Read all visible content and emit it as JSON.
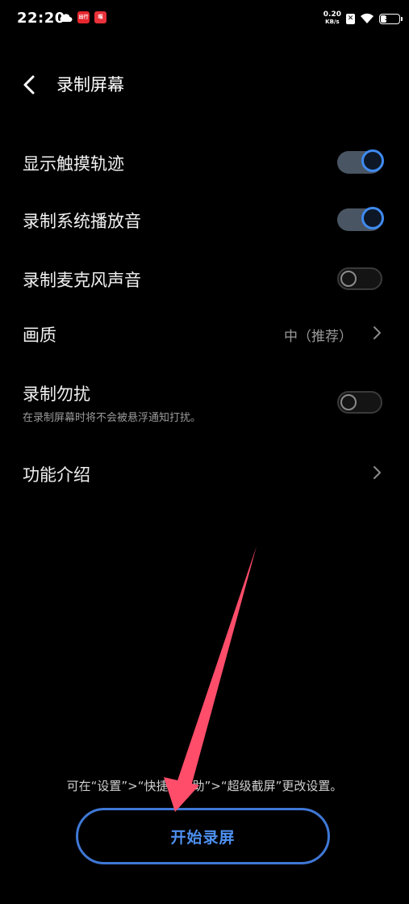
{
  "status_bar": {
    "time": "22:20",
    "badge_1": "出行",
    "badge_2": "喵",
    "net_speed_value": "0.20",
    "net_speed_unit": "KB/s",
    "battery": "38",
    "battery_level_percent": 38
  },
  "header": {
    "title": "录制屏幕"
  },
  "settings": {
    "show_touch": {
      "label": "显示触摸轨迹",
      "state": "on"
    },
    "record_system_audio": {
      "label": "录制系统播放音",
      "state": "on"
    },
    "record_mic": {
      "label": "录制麦克风声音",
      "state": "off"
    },
    "quality": {
      "label": "画质",
      "value": "中（推荐）"
    },
    "dnd": {
      "label": "录制勿扰",
      "description": "在录制屏幕时将不会被悬浮通知打扰。",
      "state": "off"
    },
    "intro": {
      "label": "功能介绍"
    }
  },
  "bottom": {
    "hint": "可在“设置”>“快捷与辅助”>“超级截屏”更改设置。",
    "start_button": "开始录屏"
  },
  "colors": {
    "accent": "#3f8af0",
    "annotation": "#ff4d6a"
  }
}
